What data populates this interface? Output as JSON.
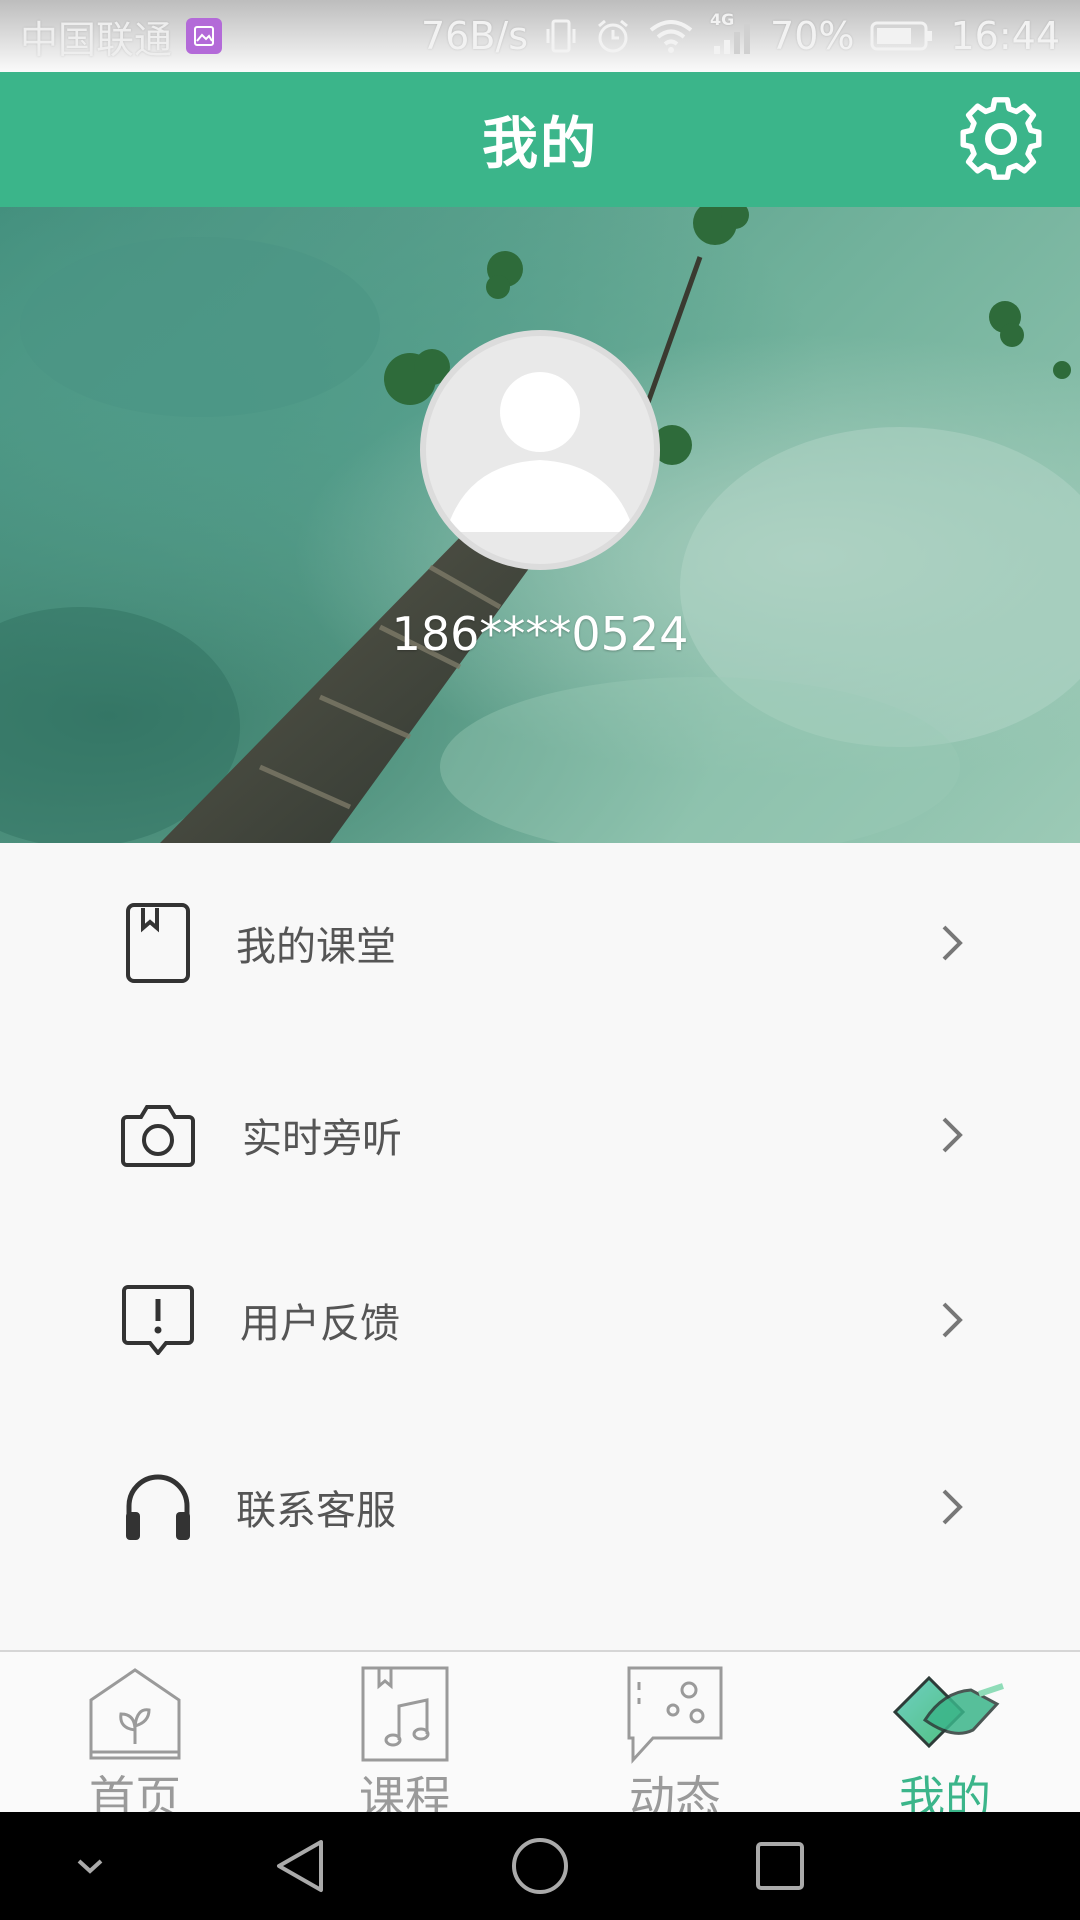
{
  "status_bar": {
    "carrier": "中国联通",
    "net_speed": "76B/s",
    "network": "4G",
    "battery": "70%",
    "time": "16:44"
  },
  "header": {
    "title": "我的",
    "settings_icon": "gear-icon"
  },
  "profile": {
    "phone": "186****0524",
    "avatar_icon": "default-avatar-icon"
  },
  "menu": [
    {
      "label": "我的课堂",
      "icon": "bookmark-book-icon"
    },
    {
      "label": "实时旁听",
      "icon": "camera-icon"
    },
    {
      "label": "用户反馈",
      "icon": "exclamation-bubble-icon"
    },
    {
      "label": "联系客服",
      "icon": "headphones-icon"
    }
  ],
  "tabs": [
    {
      "label": "首页",
      "icon": "home-plant-icon",
      "active": false
    },
    {
      "label": "课程",
      "icon": "music-book-icon",
      "active": false
    },
    {
      "label": "动态",
      "icon": "chat-bubble-icon",
      "active": false
    },
    {
      "label": "我的",
      "icon": "profile-tab-icon",
      "active": true
    }
  ],
  "colors": {
    "accent": "#3bb58a",
    "tab_inactive": "#9a9a9a",
    "menu_text": "#555555"
  }
}
